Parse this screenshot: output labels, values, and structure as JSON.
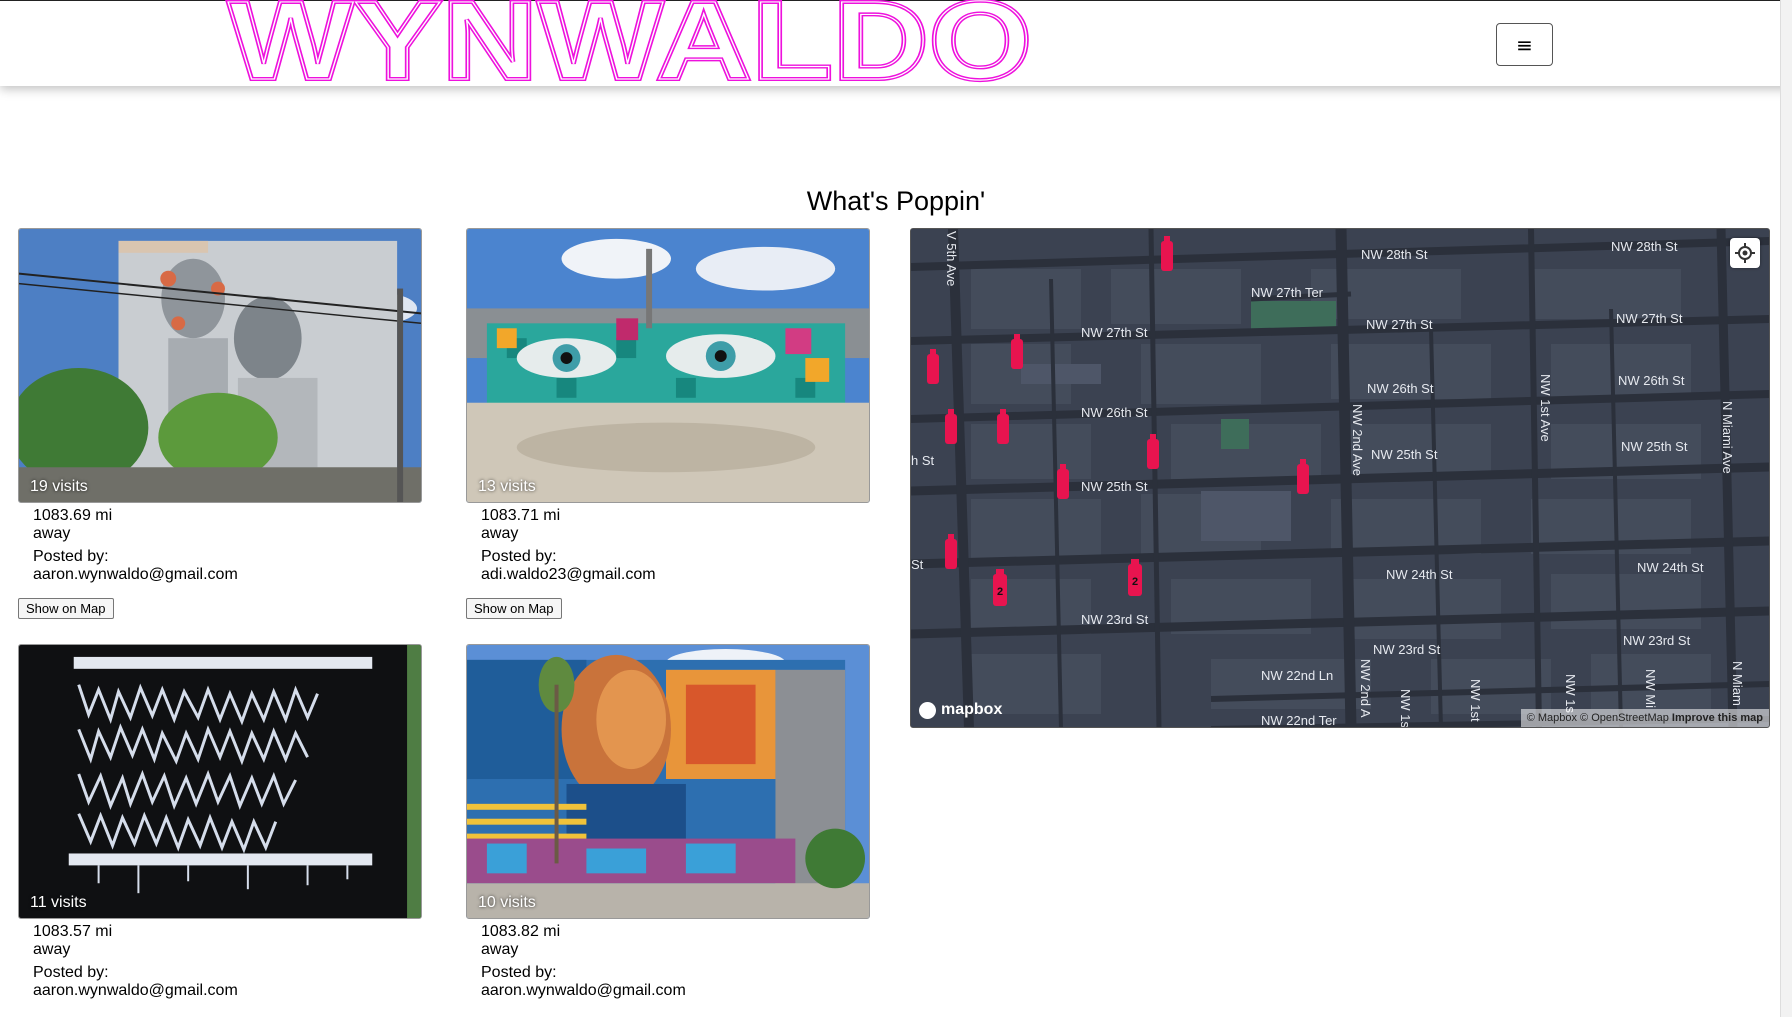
{
  "brand": {
    "logo_text": "WYNWALDO",
    "logo_color": "#ee11dd"
  },
  "nav": {
    "menu_icon": "≡"
  },
  "section": {
    "title": "What's Poppin'"
  },
  "cards": [
    {
      "visits": "19 visits",
      "distance": "1083.69 mi",
      "distance_suffix": "away",
      "posted_label": "Posted by:",
      "posted_by": "aaron.wynwaldo@gmail.com",
      "button": "Show on Map"
    },
    {
      "visits": "13 visits",
      "distance": "1083.71 mi",
      "distance_suffix": "away",
      "posted_label": "Posted by:",
      "posted_by": "adi.waldo23@gmail.com",
      "button": "Show on Map"
    },
    {
      "visits": "11 visits",
      "distance": "1083.57 mi",
      "distance_suffix": "away",
      "posted_label": "Posted by:",
      "posted_by": "aaron.wynwaldo@gmail.com"
    },
    {
      "visits": "10 visits",
      "distance": "1083.82 mi",
      "distance_suffix": "away",
      "posted_label": "Posted by:",
      "posted_by": "aaron.wynwaldo@gmail.com"
    }
  ],
  "map": {
    "streets": {
      "nw28": "NW 28th St",
      "nw28b": "NW 28th St",
      "nw27ter": "NW 27th Ter",
      "nw27": "NW 27th St",
      "nw27b": "NW 27th St",
      "nw27c": "NW 27th St",
      "nw26": "NW 26th St",
      "nw26b": "NW 26th St",
      "nw26c": "NW 26th St",
      "nw25": "NW 25th St",
      "nw25b": "NW 25th St",
      "nw25c": "NW 25th St",
      "nw24": "NW 24th St",
      "nw24b": "NW 24th St",
      "nw23": "NW 23rd St",
      "nw23b": "NW 23rd St",
      "nw23c": "NW 23rd St",
      "nw22ln": "NW 22nd Ln",
      "nw22ter": "NW 22nd Ter",
      "nw5ave": "V 5th Ave",
      "nw2ave": "NW 2nd Ave",
      "nw2aveb": "NW 2nd A",
      "nw1ave": "NW 1st Ave",
      "nmiami": "N Miami Ave",
      "nmiamib": "N Miam",
      "nw1sta": "NW 1s",
      "nw1stb": "NW 1st",
      "nw1stc": "NW 1s",
      "nw1std": "NW Mi",
      "hst": "h St",
      "st": "St"
    },
    "cluster_count": "2",
    "marker_color": "#e8144f",
    "mapbox_label": "mapbox",
    "attribution": "© Mapbox © OpenStreetMap",
    "improve": "Improve this map"
  }
}
